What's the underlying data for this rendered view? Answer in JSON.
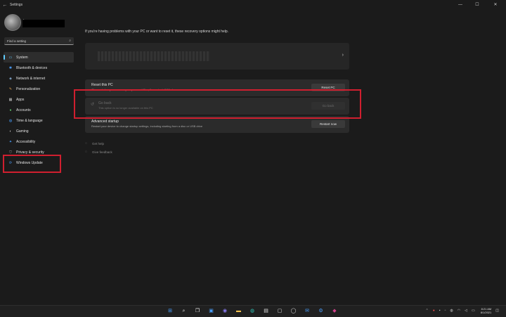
{
  "window": {
    "title": "Settings",
    "back_icon": "arrow-left-icon",
    "controls": [
      "minimize",
      "maximize",
      "close"
    ]
  },
  "profile": {
    "sub": "r"
  },
  "search": {
    "placeholder": "Find a setting"
  },
  "sidebar": {
    "items": [
      {
        "label": "System",
        "icon": "monitor-icon",
        "active": true
      },
      {
        "label": "Bluetooth & devices",
        "icon": "bluetooth-icon"
      },
      {
        "label": "Network & internet",
        "icon": "wifi-icon"
      },
      {
        "label": "Personalization",
        "icon": "brush-icon"
      },
      {
        "label": "Apps",
        "icon": "apps-icon"
      },
      {
        "label": "Accounts",
        "icon": "person-icon"
      },
      {
        "label": "Time & language",
        "icon": "globe-clock-icon"
      },
      {
        "label": "Gaming",
        "icon": "gamepad-icon"
      },
      {
        "label": "Accessibility",
        "icon": "accessibility-icon"
      },
      {
        "label": "Privacy & security",
        "icon": "shield-icon"
      },
      {
        "label": "Windows Update",
        "icon": "sync-icon"
      }
    ]
  },
  "main": {
    "intro": "If you're having problems with your PC or want to reset it, these recovery options might help.",
    "options": [
      {
        "title": "Reset this PC",
        "desc": "Choose to keep or remove your personal files, then reinstall Windows",
        "button": "Reset PC",
        "icon": "reset-icon"
      },
      {
        "title": "Go back",
        "desc": "This option is no longer available on this PC",
        "button": "Go back",
        "icon": "history-icon",
        "disabled": true
      },
      {
        "title": "Advanced startup",
        "desc": "Restart your device to change startup settings, including starting from a disc or USB drive",
        "button": "Restart now",
        "icon": "startup-icon"
      }
    ],
    "related": [
      {
        "label": "Get help",
        "icon": "help-icon"
      },
      {
        "label": "Give feedback",
        "icon": "feedback-icon"
      }
    ]
  },
  "taskbar": {
    "clock_time": "8:21 AM",
    "clock_date": "8/1/2021"
  },
  "colors": {
    "accent": "#60cdff",
    "annotation": "#d01f2f",
    "background": "#1b1b1b"
  }
}
